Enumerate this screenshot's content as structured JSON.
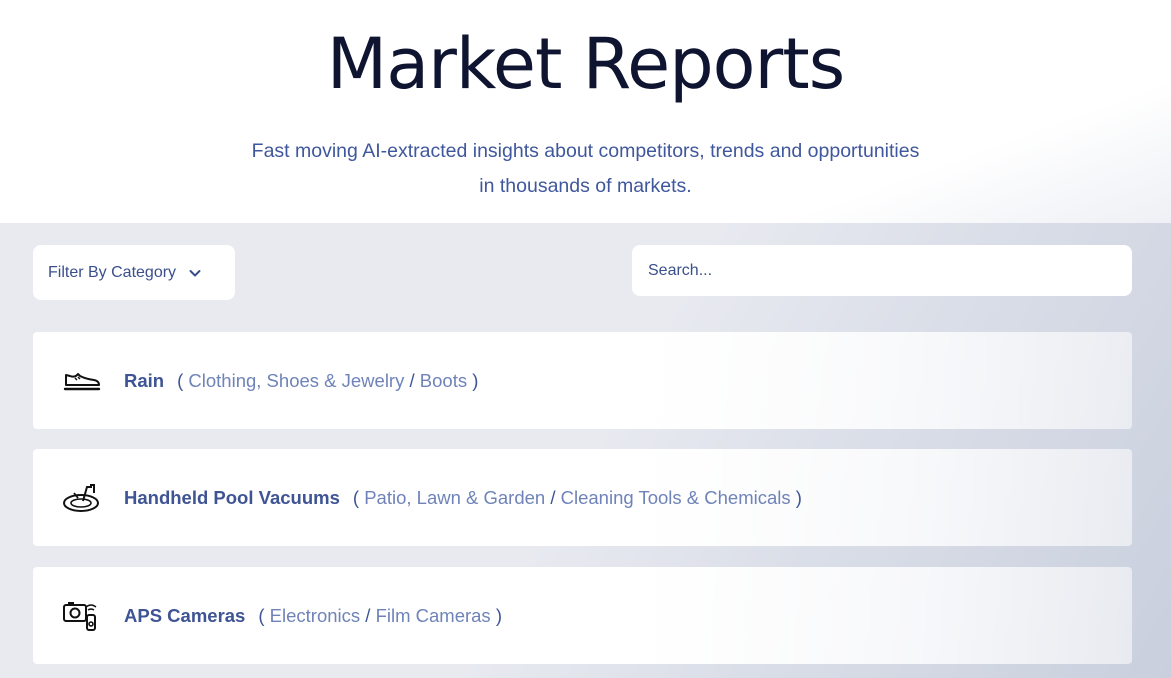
{
  "hero": {
    "title": "Market Reports",
    "subtitle_line1": "Fast moving AI-extracted insights about competitors, trends and opportunities",
    "subtitle_line2": "in thousands of markets."
  },
  "filter": {
    "label": "Filter By Category",
    "icon": "chevron-down-icon"
  },
  "search": {
    "placeholder": "Search..."
  },
  "reports": [
    {
      "name": "Rain",
      "category": "Clothing, Shoes & Jewelry",
      "subcategory": "Boots",
      "icon": "shoe-icon"
    },
    {
      "name": "Handheld Pool Vacuums",
      "category": "Patio, Lawn & Garden",
      "subcategory": "Cleaning Tools & Chemicals",
      "icon": "pool-vacuum-icon"
    },
    {
      "name": "APS Cameras",
      "category": "Electronics",
      "subcategory": "Film Cameras",
      "icon": "camera-icon"
    }
  ],
  "colors": {
    "title": "#0f1530",
    "accent": "#3e5494",
    "category": "#6f83b8",
    "background": "#e8eaf0"
  }
}
